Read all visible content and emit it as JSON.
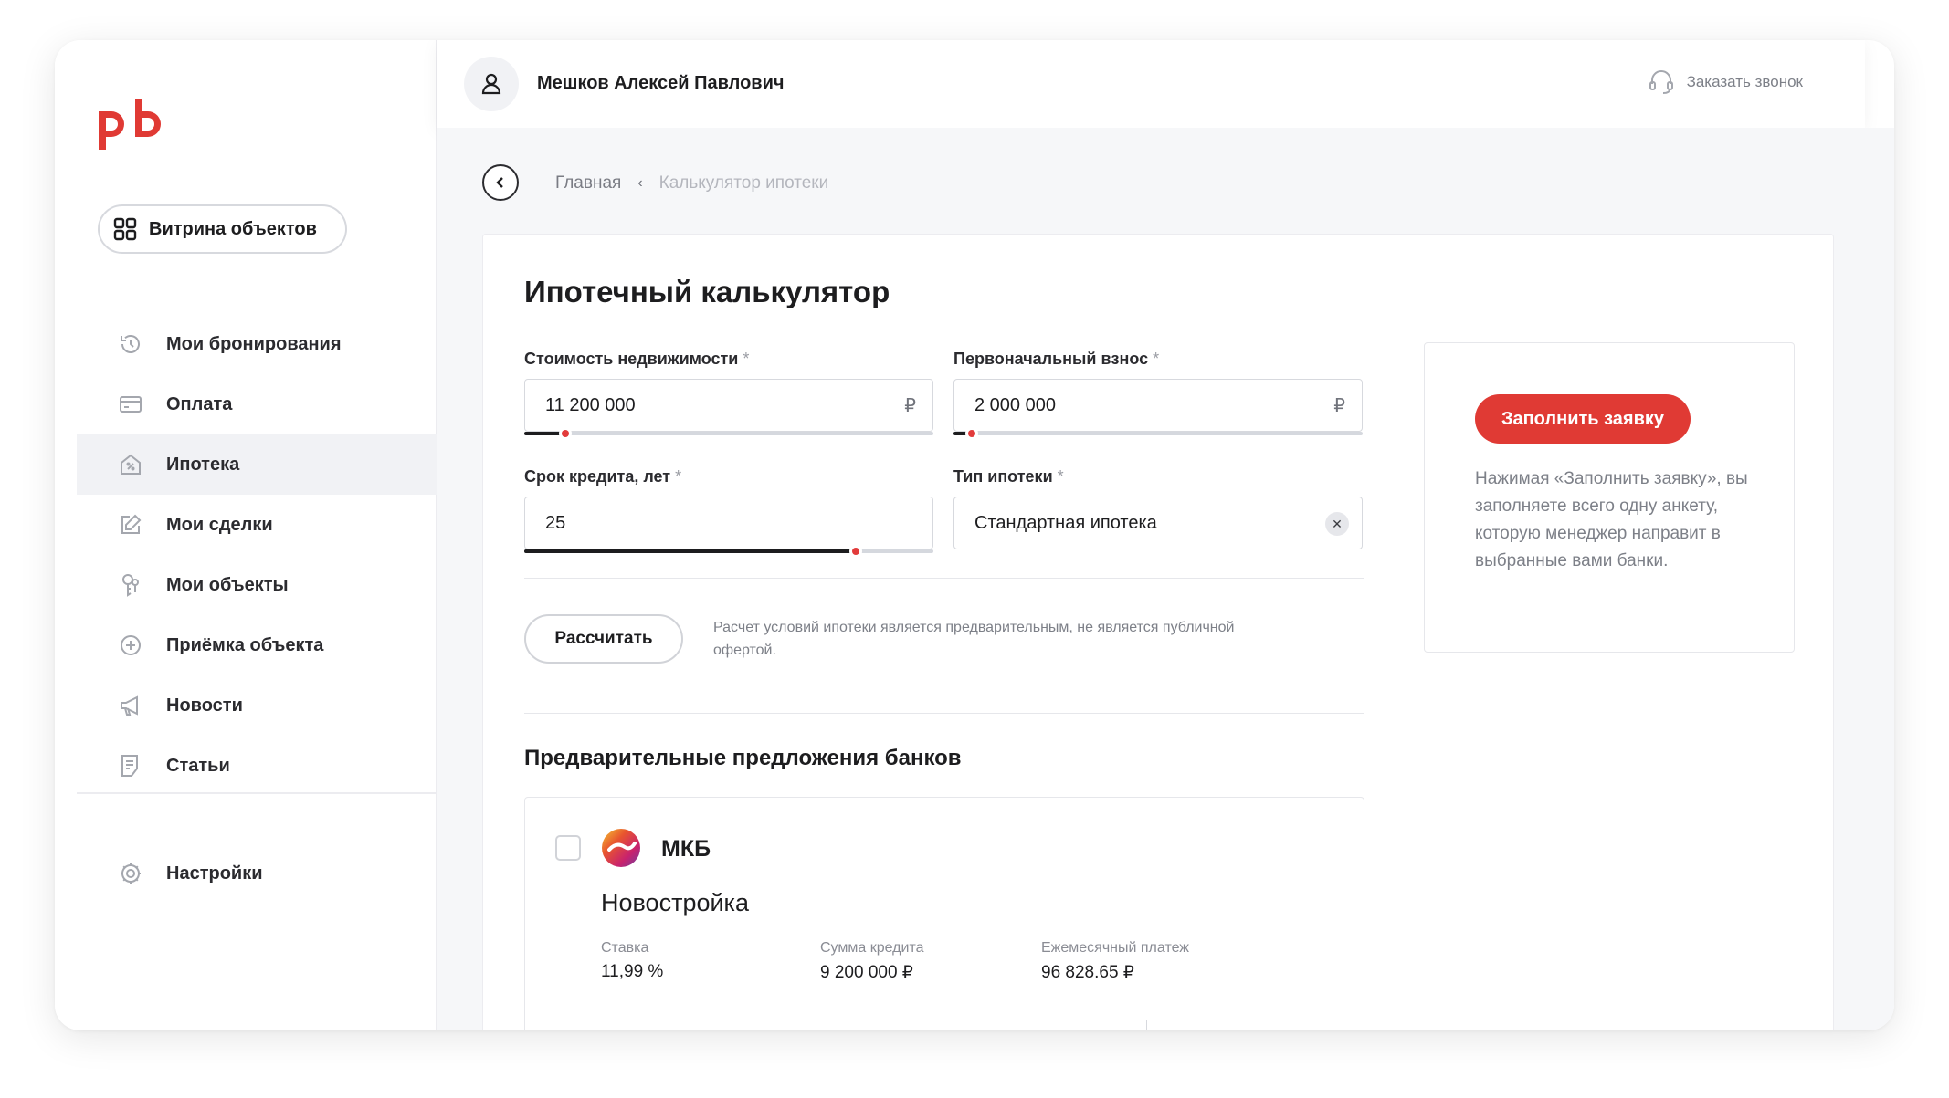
{
  "brand": {
    "logo_text": "pb",
    "accent": "#e03a34"
  },
  "sidebar": {
    "showcase_label": "Витрина объектов",
    "items": [
      {
        "label": "Мои бронирования",
        "icon": "history-icon"
      },
      {
        "label": "Оплата",
        "icon": "card-icon"
      },
      {
        "label": "Ипотека",
        "icon": "mortgage-house-icon",
        "active": true
      },
      {
        "label": "Мои сделки",
        "icon": "edit-icon"
      },
      {
        "label": "Мои объекты",
        "icon": "keys-icon"
      },
      {
        "label": "Приёмка объекта",
        "icon": "plus-circle-icon"
      },
      {
        "label": "Новости",
        "icon": "megaphone-icon"
      },
      {
        "label": "Статьи",
        "icon": "article-icon"
      }
    ],
    "settings_label": "Настройки"
  },
  "header": {
    "user_name": "Мешков Алексей Павлович",
    "callback_label": "Заказать звонок"
  },
  "breadcrumb": {
    "home": "Главная",
    "current": "Калькулятор ипотеки"
  },
  "calculator": {
    "title": "Ипотечный калькулятор",
    "price": {
      "label": "Стоимость недвижимости",
      "required": "*",
      "value": "11 200 000",
      "suffix": "₽",
      "slider_fraction": 0.1
    },
    "down_payment": {
      "label": "Первоначальный взнос",
      "required": "*",
      "value": "2 000 000",
      "suffix": "₽",
      "slider_fraction": 0.045
    },
    "term": {
      "label": "Срок кредита, лет",
      "required": "*",
      "value": "25",
      "slider_fraction": 0.81
    },
    "mortgage_type": {
      "label": "Тип ипотеки",
      "required": "*",
      "value": "Стандартная ипотека",
      "clear": "✕"
    },
    "calculate_label": "Рассчитать",
    "disclaimer": "Расчет условий ипотеки является предварительным, не является публичной офертой."
  },
  "apply": {
    "button_label": "Заполнить заявку",
    "text": "Нажимая «Заполнить заявку», вы заполняете всего одну анкету, которую менеджер направит в выбранные вами банки."
  },
  "offers": {
    "title": "Предварительные предложения банков",
    "items": [
      {
        "bank": "МКБ",
        "program": "Новостройка",
        "rate_label": "Ставка",
        "rate": "11,99 %",
        "amount_label": "Сумма кредита",
        "amount": "9 200 000 ₽",
        "payment_label": "Ежемесячный платеж",
        "payment": "96 828.65 ₽"
      }
    ]
  }
}
